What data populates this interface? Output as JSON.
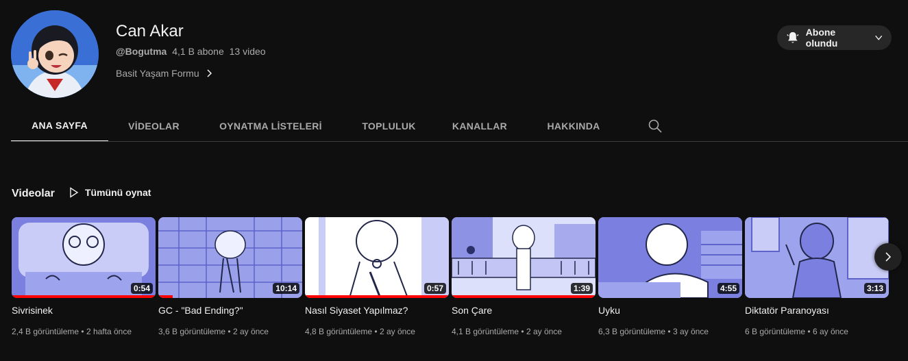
{
  "channel": {
    "name": "Can Akar",
    "handle": "@Bogutma",
    "subscribers": "4,1 B abone",
    "videos_count": "13 video",
    "description": "Basit Yaşam Formu",
    "avatar_icon": "avatar-anime-girl"
  },
  "subscribe": {
    "label": "Abone olundu",
    "icon": "bell-icon"
  },
  "tabs": [
    {
      "label": "ANA SAYFA",
      "active": true
    },
    {
      "label": "VİDEOLAR"
    },
    {
      "label": "OYNATMA LİSTELERİ"
    },
    {
      "label": "TOPLULUK"
    },
    {
      "label": "KANALLAR"
    },
    {
      "label": "HAKKINDA"
    }
  ],
  "section": {
    "title": "Videolar",
    "play_all": "Tümünü oynat"
  },
  "videos": [
    {
      "title": "Sivrisinek",
      "views": "2,4 B görüntüleme",
      "age": "2 hafta önce",
      "duration": "0:54",
      "watched": 1.0
    },
    {
      "title": "GC - \"Bad Ending?\"",
      "views": "3,6 B görüntüleme",
      "age": "2 ay önce",
      "duration": "10:14",
      "watched": 0.1
    },
    {
      "title": "Nasıl Siyaset Yapılmaz?",
      "views": "4,8 B görüntüleme",
      "age": "2 ay önce",
      "duration": "0:57",
      "watched": 1.0
    },
    {
      "title": "Son Çare",
      "views": "4,1 B görüntüleme",
      "age": "2 ay önce",
      "duration": "1:39",
      "watched": 1.0
    },
    {
      "title": "Uyku",
      "views": "6,3 B görüntüleme",
      "age": "3 ay önce",
      "duration": "4:55",
      "watched": 0
    },
    {
      "title": "Diktatör Paranoyası",
      "views": "6 B görüntüleme",
      "age": "6 ay önce",
      "duration": "3:13",
      "watched": 0
    }
  ],
  "colors": {
    "background": "#0f0f0f",
    "progress": "#ff0000",
    "thumb_tint": "#7b80e0"
  }
}
